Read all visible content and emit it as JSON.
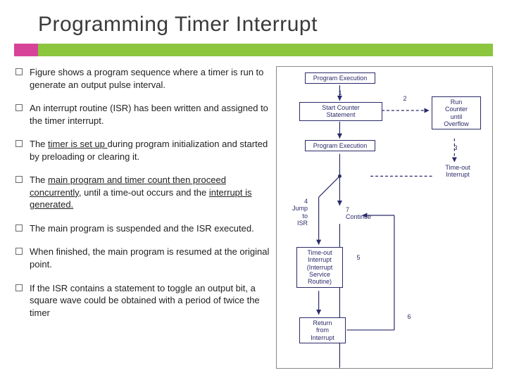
{
  "title": "Programming Timer Interrupt",
  "bullets": [
    {
      "pre": "Figure shows a program sequence where a timer is run to generate an output pulse interval.",
      "u1": "",
      "mid": "",
      "u2": "",
      "post": ""
    },
    {
      "pre": "An interrupt routine (ISR) has been written and assigned to the timer interrupt.",
      "u1": "",
      "mid": "",
      "u2": "",
      "post": ""
    },
    {
      "pre": "The ",
      "u1": "timer is set up ",
      "mid": "during program initialization and started by preloading or clearing it.",
      "u2": "",
      "post": ""
    },
    {
      "pre": "The ",
      "u1": "main program and timer count then proceed concurrently",
      "mid": ", until a time-out occurs and the ",
      "u2": "interrupt is generated.",
      "post": ""
    },
    {
      "pre": "The main program is suspended and the ISR executed.",
      "u1": "",
      "mid": "",
      "u2": "",
      "post": ""
    },
    {
      "pre": "When finished, the main program is resumed at the original point.",
      "u1": "",
      "mid": "",
      "u2": "",
      "post": ""
    },
    {
      "pre": "If the ISR contains a statement to toggle an output bit, a square wave could be obtained with a period of twice the timer",
      "u1": "",
      "mid": "",
      "u2": "",
      "post": ""
    }
  ],
  "diagram": {
    "boxes": {
      "pexec_top": "Program Execution",
      "start_counter": "Start Counter\nStatement",
      "run_counter": "Run\nCounter\nuntil\nOverflow",
      "pexec_mid": "Program Execution",
      "jump_isr": "Jump\nto\nISR",
      "continue": "Continue",
      "timeout_int": "Time-out\nInterrupt\n(Interrupt\nService\nRoutine)",
      "return_int": "Return\nfrom\nInterrupt"
    },
    "labels": {
      "n1": "1",
      "n2": "2",
      "n3": "3",
      "n4": "4",
      "n5": "5",
      "n6": "6",
      "n7": "7",
      "timeout_int_label": "Time-out\nInterrupt"
    }
  }
}
